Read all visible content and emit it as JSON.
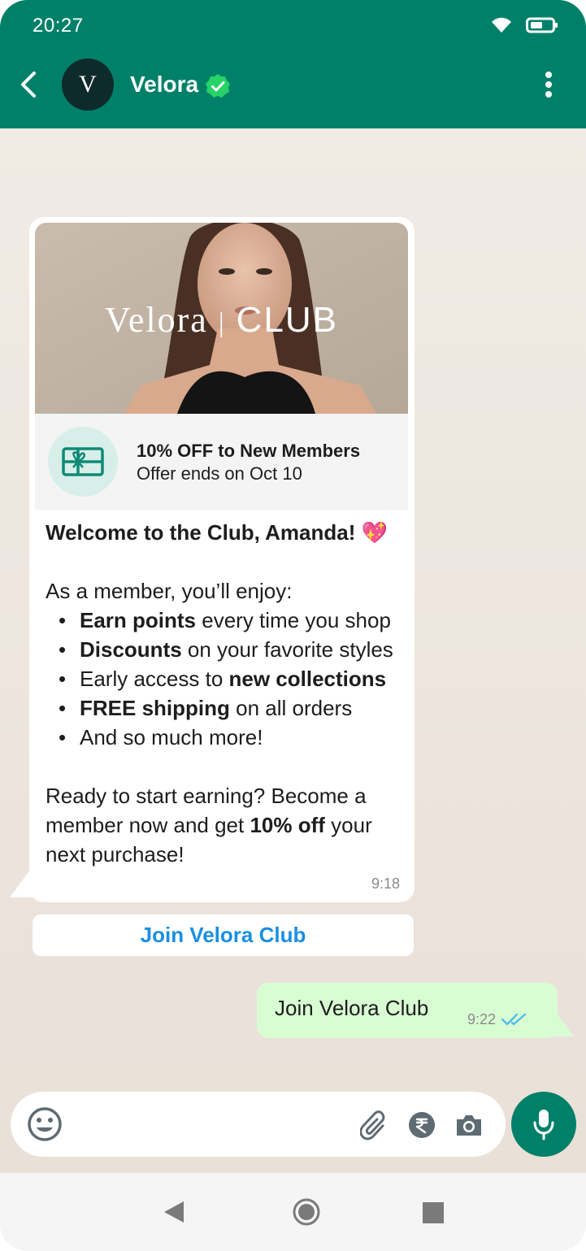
{
  "status_bar": {
    "time": "20:27"
  },
  "header": {
    "avatar_letter": "V",
    "contact_name": "Velora",
    "verified": true
  },
  "incoming": {
    "hero_brand": "Velora",
    "hero_separator": "|",
    "hero_club": "CLUB",
    "offer_title": "10% OFF to New Members",
    "offer_subtitle": "Offer ends on Oct 10",
    "greeting": "Welcome to the Club, Amanda!",
    "greeting_emoji": "💖",
    "intro": "As a member, you’ll enjoy:",
    "bullets": [
      {
        "bold": "Earn points",
        "rest": " every time you shop",
        "bold_first": true
      },
      {
        "bold": "Discounts",
        "rest": " on your favorite styles",
        "bold_first": true
      },
      {
        "pre": "Early access to ",
        "bold": "new collections",
        "bold_first": false
      },
      {
        "bold": "FREE shipping",
        "rest": " on all orders",
        "bold_first": true
      },
      {
        "pre": "And so much more!",
        "bold": "",
        "bold_first": false
      }
    ],
    "closing_line1": "Ready to start earning? Become a",
    "closing_line2_pre": "member now and get ",
    "closing_line2_bold": "10% off",
    "closing_line2_post": " your",
    "closing_line3": "next purchase!",
    "time": "9:18",
    "cta_label": "Join Velora Club"
  },
  "outgoing": {
    "text": "Join Velora Club",
    "time": "9:22",
    "read": true
  },
  "input": {
    "placeholder": ""
  },
  "colors": {
    "header": "#008069",
    "outgoing_bubble": "#d9fdd3",
    "link": "#1a8fe0",
    "read_ticks": "#53bdeb"
  }
}
